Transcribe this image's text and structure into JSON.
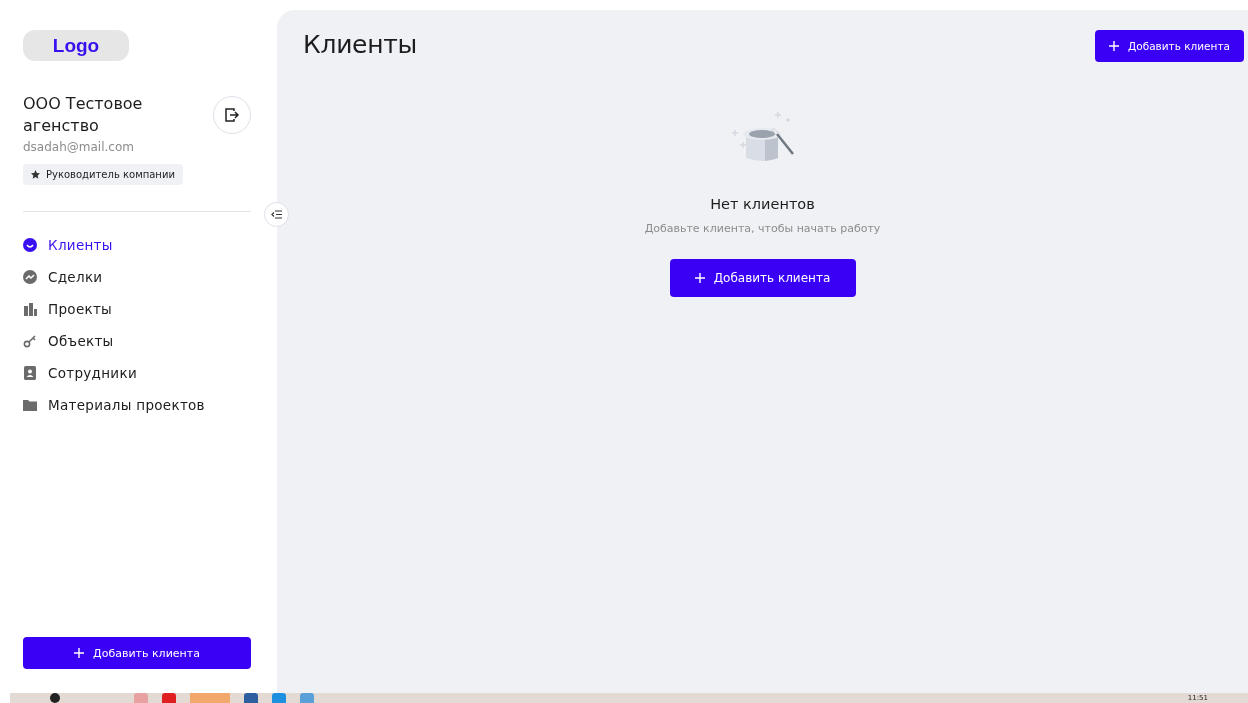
{
  "sidebar": {
    "logo": "Logo",
    "company": "ООО Тестовое агенство",
    "email": "dsadah@mail.com",
    "role": "Руководитель компании",
    "items": [
      {
        "label": "Клиенты",
        "kind": "clients",
        "selected": true
      },
      {
        "label": "Сделки",
        "kind": "deals",
        "selected": false
      },
      {
        "label": "Проекты",
        "kind": "projects",
        "selected": false
      },
      {
        "label": "Объекты",
        "kind": "objects",
        "selected": false
      },
      {
        "label": "Сотрудники",
        "kind": "staff",
        "selected": false
      },
      {
        "label": "Материалы проектов",
        "kind": "materials",
        "selected": false
      }
    ],
    "add_button": "Добавить клиента"
  },
  "main": {
    "title": "Клиенты",
    "add_button": "Добавить клиента",
    "empty": {
      "title": "Нет клиентов",
      "text": "Добавьте клиента, чтобы начать работу",
      "button": "Добавить клиента"
    }
  },
  "taskbar": {
    "time": "11:51"
  }
}
